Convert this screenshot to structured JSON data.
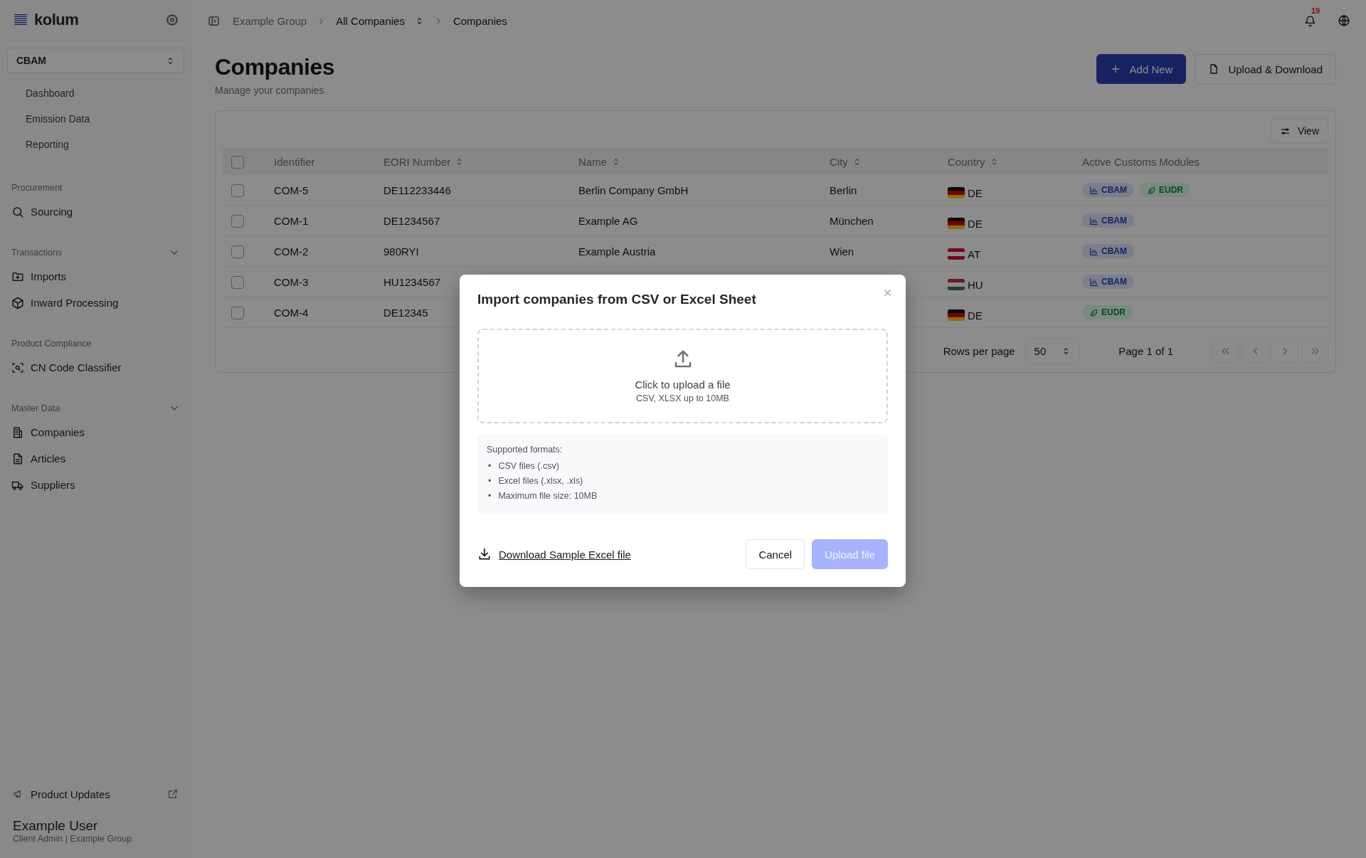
{
  "sidebar": {
    "logo": "kolum",
    "module_selector": "CBAM",
    "module_items": [
      {
        "label": "Dashboard"
      },
      {
        "label": "Emission Data"
      },
      {
        "label": "Reporting"
      }
    ],
    "sections": [
      {
        "title": "Procurement",
        "collapsible": false,
        "items": [
          {
            "label": "Sourcing"
          }
        ]
      },
      {
        "title": "Transactions",
        "collapsible": true,
        "items": [
          {
            "label": "Imports"
          },
          {
            "label": "Inward Processing"
          }
        ]
      },
      {
        "title": "Product Compliance",
        "collapsible": false,
        "items": [
          {
            "label": "CN Code Classifier"
          }
        ]
      },
      {
        "title": "Master Data",
        "collapsible": true,
        "items": [
          {
            "label": "Companies"
          },
          {
            "label": "Articles"
          },
          {
            "label": "Suppliers"
          }
        ]
      }
    ],
    "product_updates": "Product Updates",
    "user": {
      "name": "Example User",
      "role": "Client Admin | Example Group"
    }
  },
  "header": {
    "breadcrumbs": [
      {
        "label": "Example Group",
        "muted": true,
        "switcher": false
      },
      {
        "label": "All Companies",
        "muted": false,
        "switcher": true
      },
      {
        "label": "Companies",
        "muted": false,
        "switcher": false
      }
    ],
    "notifications": "19"
  },
  "page": {
    "title": "Companies",
    "subtitle": "Manage your companies",
    "buttons": [
      {
        "label": "Add New",
        "kind": "primary"
      },
      {
        "label": "Upload & Download",
        "kind": "outline"
      }
    ]
  },
  "table": {
    "view_button": "View",
    "all_checked": false,
    "columns": [
      {
        "label": "Identifier",
        "sortable": false
      },
      {
        "label": "EORI Number",
        "sortable": true
      },
      {
        "label": "Name",
        "sortable": true
      },
      {
        "label": "City",
        "sortable": true
      },
      {
        "label": "Country",
        "sortable": true
      },
      {
        "label": "Active Customs Modules",
        "sortable": false
      }
    ],
    "rows": [
      {
        "checked": false,
        "identifier": "COM-5",
        "eori": "DE112233446",
        "name": "Berlin Company GmbH",
        "city": "Berlin",
        "country": "DE",
        "modules": [
          {
            "label": "CBAM",
            "kind": "cbam"
          },
          {
            "label": "EUDR",
            "kind": "eudr"
          }
        ]
      },
      {
        "checked": false,
        "identifier": "COM-1",
        "eori": "DE1234567",
        "name": "Example AG",
        "city": "München",
        "country": "DE",
        "modules": [
          {
            "label": "CBAM",
            "kind": "cbam"
          }
        ]
      },
      {
        "checked": false,
        "identifier": "COM-2",
        "eori": "980RYI",
        "name": "Example Austria",
        "city": "Wien",
        "country": "AT",
        "modules": [
          {
            "label": "CBAM",
            "kind": "cbam"
          }
        ]
      },
      {
        "checked": false,
        "identifier": "COM-3",
        "eori": "HU1234567",
        "country": "HU",
        "modules": [
          {
            "label": "CBAM",
            "kind": "cbam"
          }
        ]
      },
      {
        "checked": false,
        "identifier": "COM-4",
        "eori": "DE12345",
        "country": "DE",
        "modules": [
          {
            "label": "EUDR",
            "kind": "eudr"
          }
        ]
      }
    ],
    "pagination": {
      "rows_per_page_label": "Rows per page",
      "rows_per_page": "50",
      "page": "Page 1 of 1"
    }
  },
  "dialog": {
    "title": "Import companies from CSV or Excel Sheet",
    "dropzone_title": "Click to upload a file",
    "dropzone_hint": "CSV, XLSX up to 10MB",
    "formats_title": "Supported formats:",
    "formats": [
      {
        "marker": "•",
        "text": "CSV files (.csv)"
      },
      {
        "marker": "•",
        "text": "Excel files (.xlsx, .xls)"
      },
      {
        "marker": "•",
        "text": "Maximum file size: 10MB"
      }
    ],
    "download_link": "Download Sample Excel file",
    "cancel": "Cancel",
    "upload": {
      "label": "Upload file",
      "disabled": true
    }
  }
}
